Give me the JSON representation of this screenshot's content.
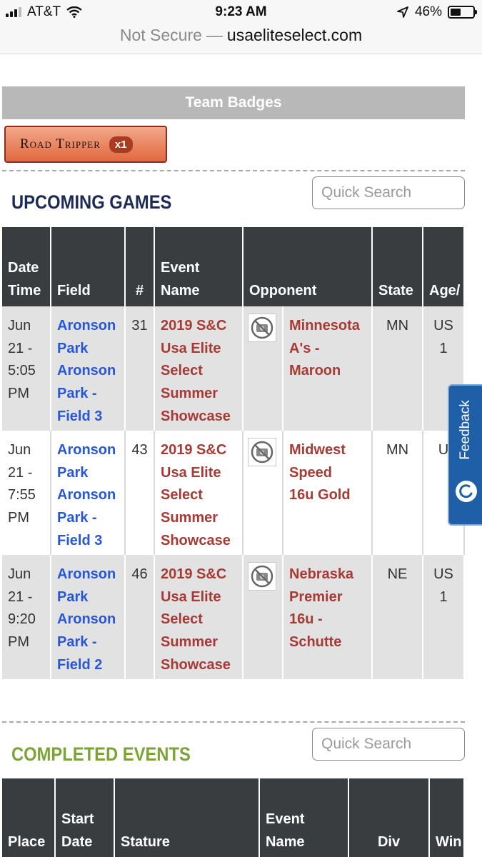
{
  "status_bar": {
    "carrier": "AT&T",
    "time": "9:23 AM",
    "battery": "46%",
    "battery_level": 0.46
  },
  "address_bar": {
    "security": "Not Secure",
    "separator": "—",
    "domain": "usaeliteselect.com"
  },
  "team_badges": {
    "title": "Team Badges",
    "badge": {
      "name": "Road Tripper",
      "count": "x1"
    }
  },
  "upcoming": {
    "title": "UPCOMING GAMES",
    "search_placeholder": "Quick Search",
    "columns": [
      [
        "Date",
        "Time"
      ],
      [
        "Field"
      ],
      [
        "#"
      ],
      [
        "Event",
        "Name"
      ],
      [
        "Opponent"
      ],
      [
        "State"
      ],
      [
        "Age/"
      ]
    ],
    "rows": [
      {
        "time": [
          "Jun",
          "21 -",
          "5:05",
          "PM"
        ],
        "field": [
          "Aronson",
          "Park",
          "Aronson",
          "Park -",
          "Field 3"
        ],
        "num": "31",
        "event": [
          "2019 S&C",
          "Usa Elite",
          "Select",
          "Summer",
          "Showcase"
        ],
        "opponent": [
          "Minnesota",
          "A's -",
          "Maroon"
        ],
        "state": "MN",
        "age": [
          "US",
          "1"
        ]
      },
      {
        "time": [
          "Jun",
          "21 -",
          "7:55",
          "PM"
        ],
        "field": [
          "Aronson",
          "Park",
          "Aronson",
          "Park -",
          "Field 3"
        ],
        "num": "43",
        "event": [
          "2019 S&C",
          "Usa Elite",
          "Select",
          "Summer",
          "Showcase"
        ],
        "opponent": [
          "Midwest",
          "Speed",
          "16u Gold"
        ],
        "state": "MN",
        "age": [
          "U"
        ]
      },
      {
        "time": [
          "Jun",
          "21 -",
          "9:20",
          "PM"
        ],
        "field": [
          "Aronson",
          "Park",
          "Aronson",
          "Park -",
          "Field 2"
        ],
        "num": "46",
        "event": [
          "2019 S&C",
          "Usa Elite",
          "Select",
          "Summer",
          "Showcase"
        ],
        "opponent": [
          "Nebraska",
          "Premier",
          "16u -",
          "Schutte"
        ],
        "state": "NE",
        "age": [
          "US",
          "1"
        ]
      }
    ]
  },
  "completed": {
    "title": "COMPLETED EVENTS",
    "search_placeholder": "Quick Search",
    "columns": [
      [
        "Place"
      ],
      [
        "Start",
        "Date"
      ],
      [
        "Stature"
      ],
      [
        "Event",
        "Name"
      ],
      [
        "Div"
      ],
      [
        "Win"
      ]
    ]
  },
  "feedback": {
    "label": "Feedback"
  }
}
